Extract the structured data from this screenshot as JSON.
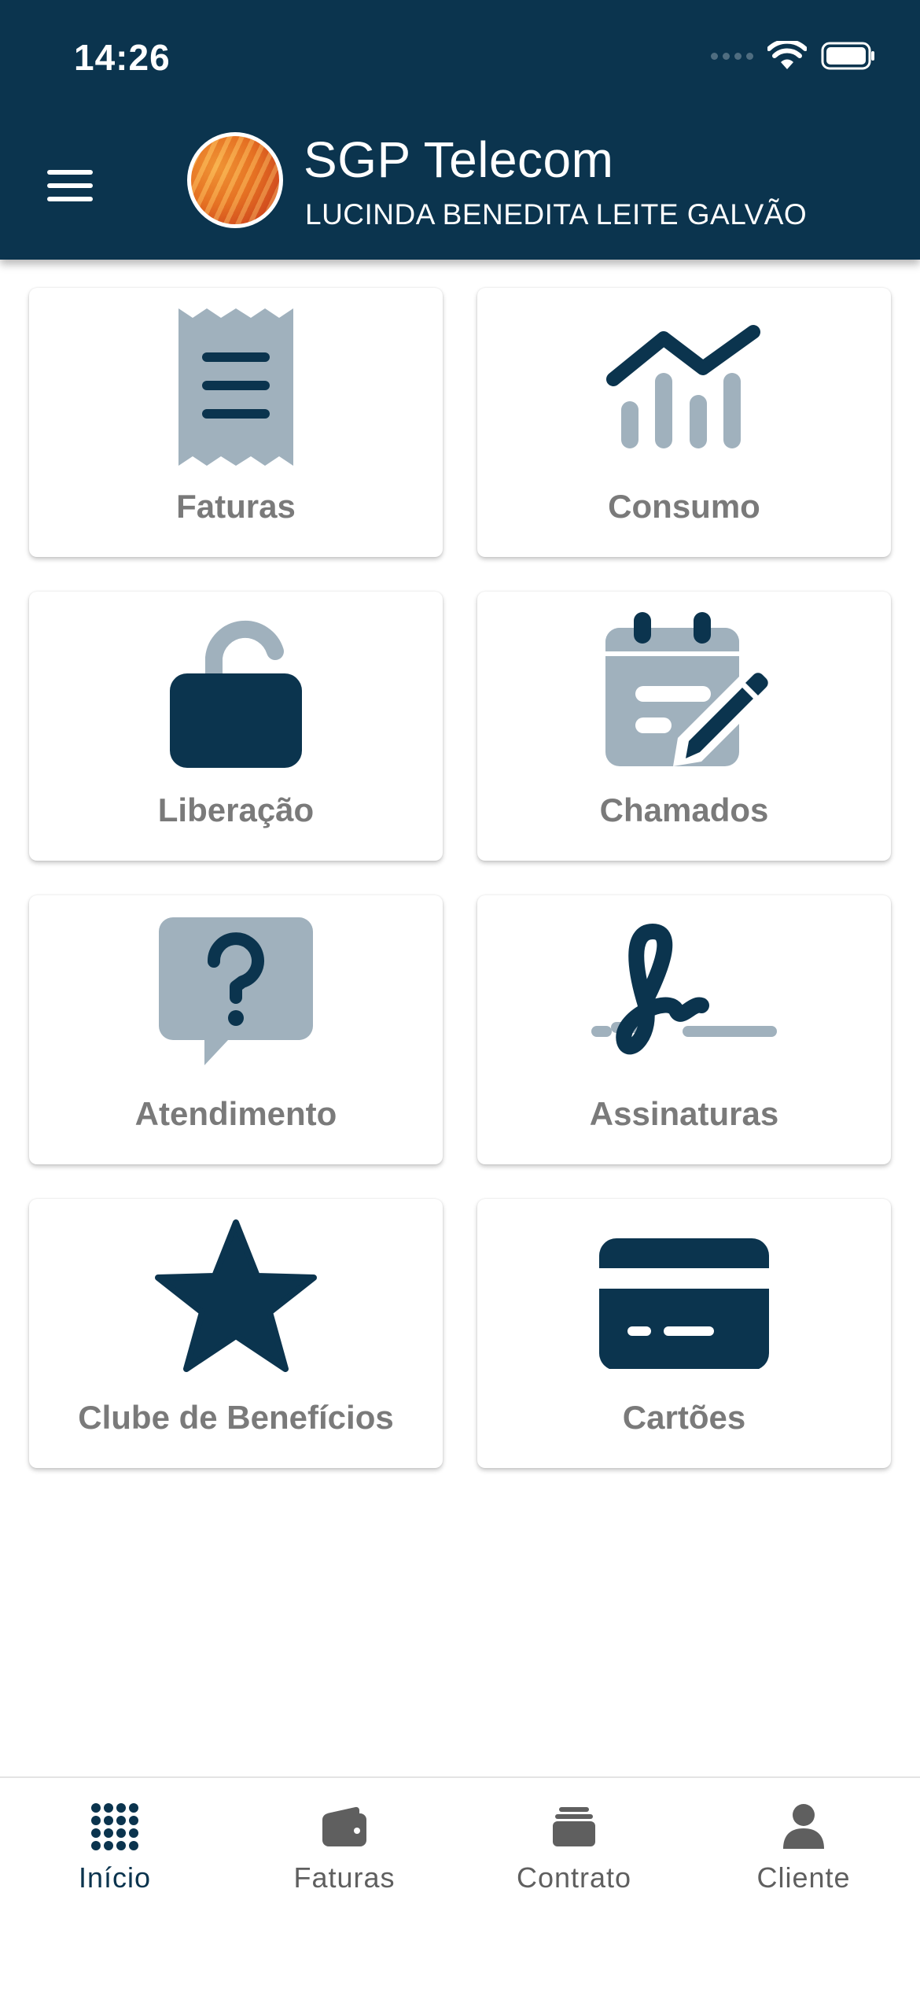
{
  "status_bar": {
    "time": "14:26"
  },
  "header": {
    "title": "SGP Telecom",
    "subtitle": "LUCINDA BENEDITA LEITE GALVÃO"
  },
  "colors": {
    "primary": "#0b344e",
    "icon_muted": "#a0b1bd",
    "label": "#7a7a7a"
  },
  "menu": [
    {
      "label": "Faturas",
      "icon": "receipt-icon"
    },
    {
      "label": "Consumo",
      "icon": "chart-icon"
    },
    {
      "label": "Liberação",
      "icon": "unlock-icon"
    },
    {
      "label": "Chamados",
      "icon": "calendar-edit-icon"
    },
    {
      "label": "Atendimento",
      "icon": "help-chat-icon"
    },
    {
      "label": "Assinaturas",
      "icon": "signature-icon"
    },
    {
      "label": "Clube de Benefícios",
      "icon": "star-icon"
    },
    {
      "label": "Cartões",
      "icon": "credit-card-icon"
    }
  ],
  "bottom_nav": [
    {
      "label": "Início",
      "icon": "grid-icon",
      "active": true
    },
    {
      "label": "Faturas",
      "icon": "wallet-icon",
      "active": false
    },
    {
      "label": "Contrato",
      "icon": "layers-icon",
      "active": false
    },
    {
      "label": "Cliente",
      "icon": "person-icon",
      "active": false
    }
  ]
}
